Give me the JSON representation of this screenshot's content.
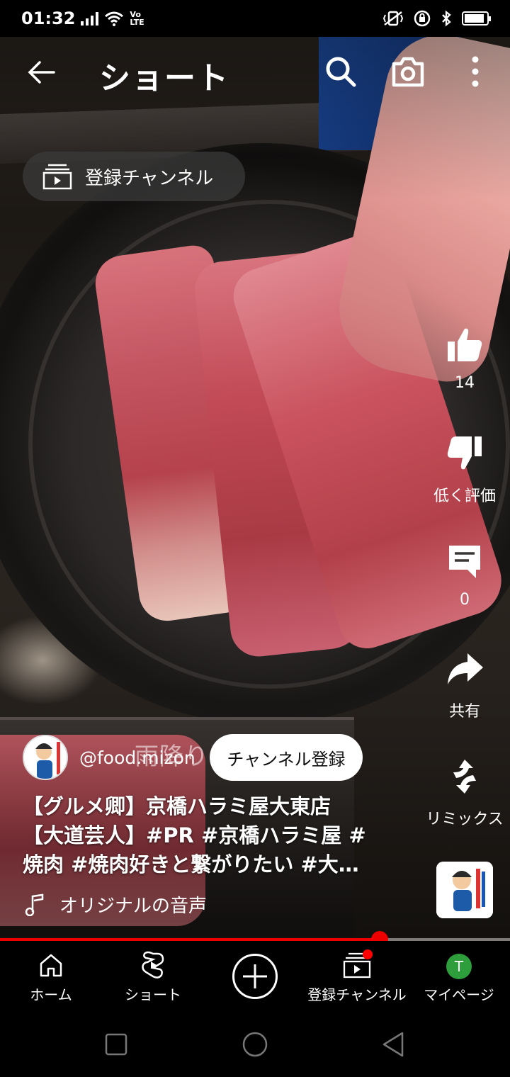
{
  "status_bar": {
    "time": "01:32",
    "volte_top": "Vo",
    "volte_bottom": "LTE",
    "battery_level": 0.9
  },
  "top_bar": {
    "title": "ショート"
  },
  "subscriptions_chip": {
    "label": "登録チャンネル"
  },
  "video": {
    "overlay_caption": "雨降り"
  },
  "actions": {
    "like_count": "14",
    "dislike_label": "低く評価",
    "comment_count": "0",
    "share_label": "共有",
    "remix_label": "リミックス"
  },
  "channel": {
    "handle": "@food.mizon",
    "subscribe_label": "チャンネル登録"
  },
  "description": {
    "line1": "【グルメ卿】京橋ハラミ屋大東店",
    "line2": "【大道芸人】#PR #京橋ハラミ屋 #",
    "line3": "焼肉 #焼肉好きと繋がりたい #大…"
  },
  "sound": {
    "label": "オリジナルの音声"
  },
  "progress": {
    "played_fraction": 0.745
  },
  "bottom_nav": {
    "home": "ホーム",
    "shorts": "ショート",
    "subscriptions": "登録チャンネル",
    "my_page": "マイページ",
    "avatar_initial": "T"
  },
  "colors": {
    "accent_red": "#ff0000",
    "avatar_green": "#2e9e3c"
  }
}
